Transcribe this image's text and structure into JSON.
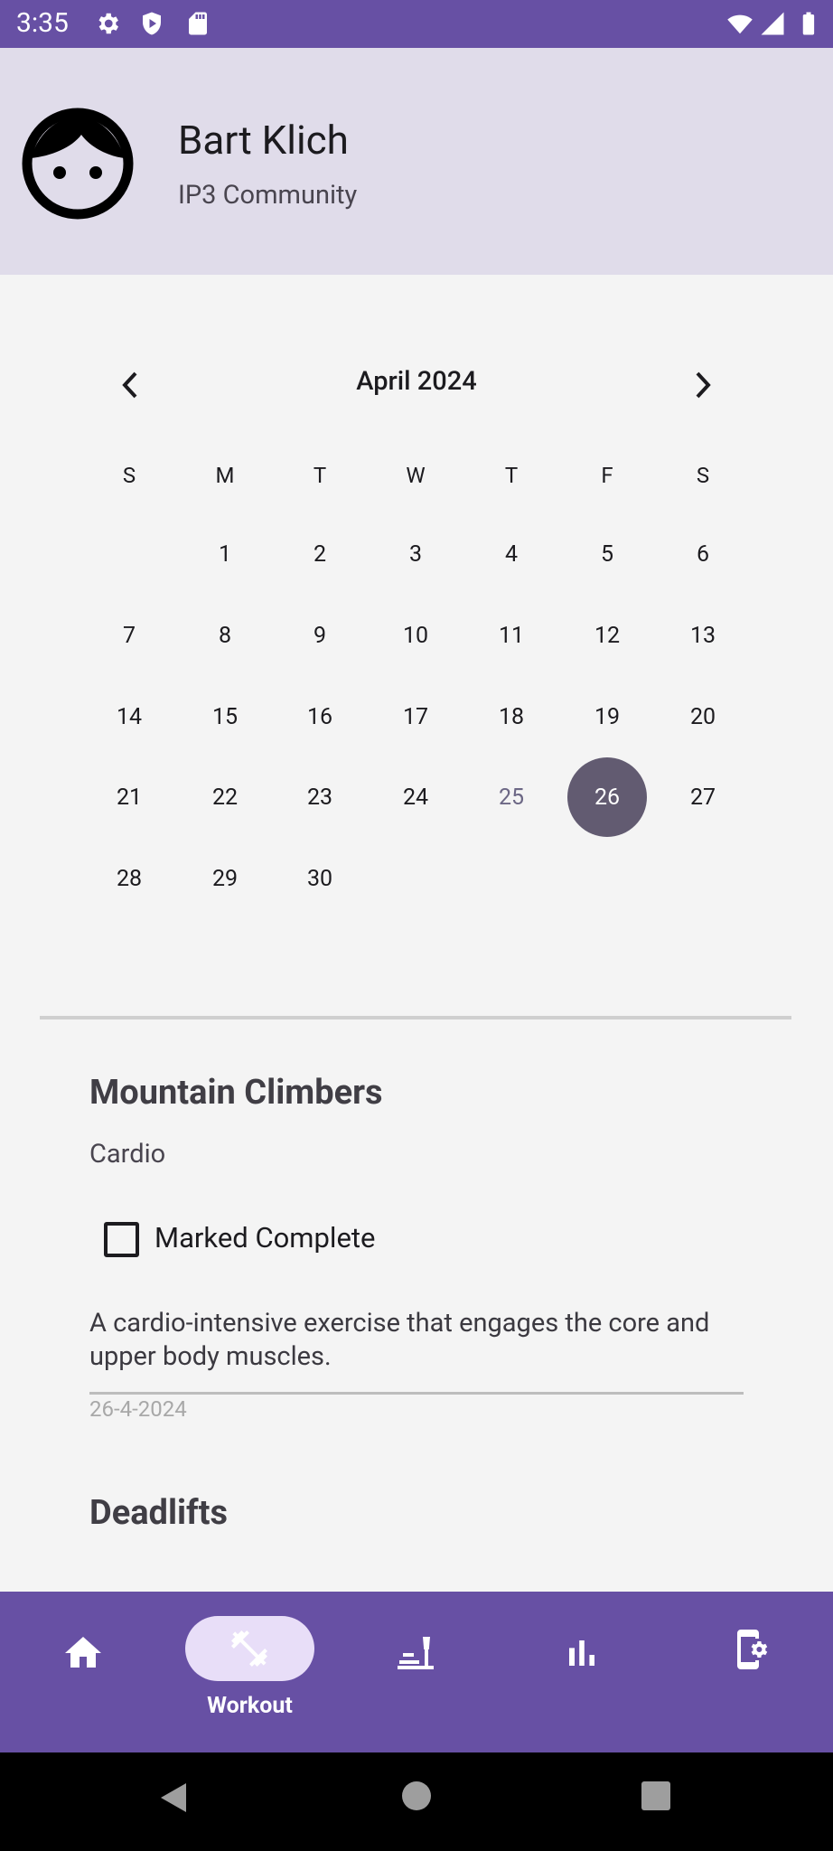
{
  "status_bar": {
    "time": "3:35"
  },
  "profile": {
    "name": "Bart Klich",
    "community": "IP3 Community"
  },
  "calendar": {
    "month_label": "April 2024",
    "weekdays": [
      "S",
      "M",
      "T",
      "W",
      "T",
      "F",
      "S"
    ],
    "weeks": [
      [
        "",
        "1",
        "2",
        "3",
        "4",
        "5",
        "6"
      ],
      [
        "7",
        "8",
        "9",
        "10",
        "11",
        "12",
        "13"
      ],
      [
        "14",
        "15",
        "16",
        "17",
        "18",
        "19",
        "20"
      ],
      [
        "21",
        "22",
        "23",
        "24",
        "25",
        "26",
        "27"
      ],
      [
        "28",
        "29",
        "30",
        "",
        "",
        "",
        ""
      ]
    ],
    "today": "25",
    "selected": "26"
  },
  "exercises": [
    {
      "title": "Mountain Climbers",
      "category": "Cardio",
      "complete_label": "Marked Complete",
      "completed": false,
      "description": "A cardio-intensive exercise that engages the core and upper body muscles.",
      "date": "26-4-2024"
    },
    {
      "title": "Deadlifts"
    }
  ],
  "bottom_nav": {
    "active": "Workout",
    "items": [
      {
        "icon": "home-icon"
      },
      {
        "icon": "dumbbell-icon",
        "label": "Workout"
      },
      {
        "icon": "nutrition-icon"
      },
      {
        "icon": "stats-icon"
      },
      {
        "icon": "device-settings-icon"
      }
    ]
  },
  "colors": {
    "primary": "#6750a4",
    "header_bg": "#e0dcea",
    "selected_day": "#625b71",
    "nav_pill": "#e8def8"
  }
}
